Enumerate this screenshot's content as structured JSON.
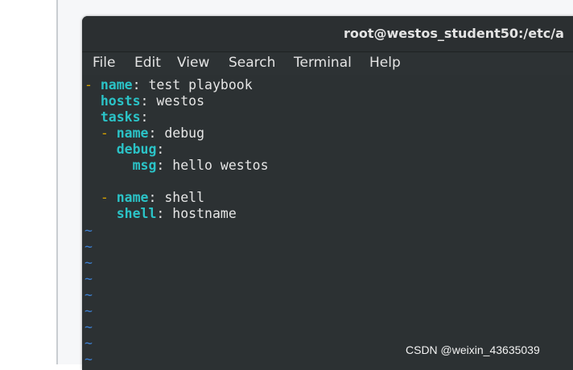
{
  "window": {
    "title": "root@westos_student50:/etc/a"
  },
  "menubar": {
    "items": [
      {
        "label": "File"
      },
      {
        "label": "Edit"
      },
      {
        "label": "View"
      },
      {
        "label": "Search"
      },
      {
        "label": "Terminal"
      },
      {
        "label": "Help"
      }
    ]
  },
  "editor": {
    "lines": [
      {
        "dash": "-",
        "key": "name",
        "sep": ":",
        "value": " test playbook"
      },
      {
        "key": "hosts",
        "sep": ":",
        "value": " westos"
      },
      {
        "key": "tasks",
        "sep": ":"
      },
      {
        "dash": "-",
        "key": "name",
        "sep": ":",
        "value": " debug"
      },
      {
        "key": "debug",
        "sep": ":"
      },
      {
        "key": "msg",
        "sep": ":",
        "value": " hello westos"
      },
      {
        "dash": "-",
        "key": "name",
        "sep": ":",
        "value": " shell"
      },
      {
        "key": "shell",
        "sep": ":",
        "value": " hostname"
      }
    ],
    "tilde": "~"
  },
  "watermark": "CSDN @weixin_43635039",
  "colors": {
    "terminal_bg": "#2c3133",
    "yaml_key": "#2bc3c7",
    "list_dash": "#d6a100",
    "tilde": "#3d7fd0",
    "text": "#e6e6e6"
  }
}
